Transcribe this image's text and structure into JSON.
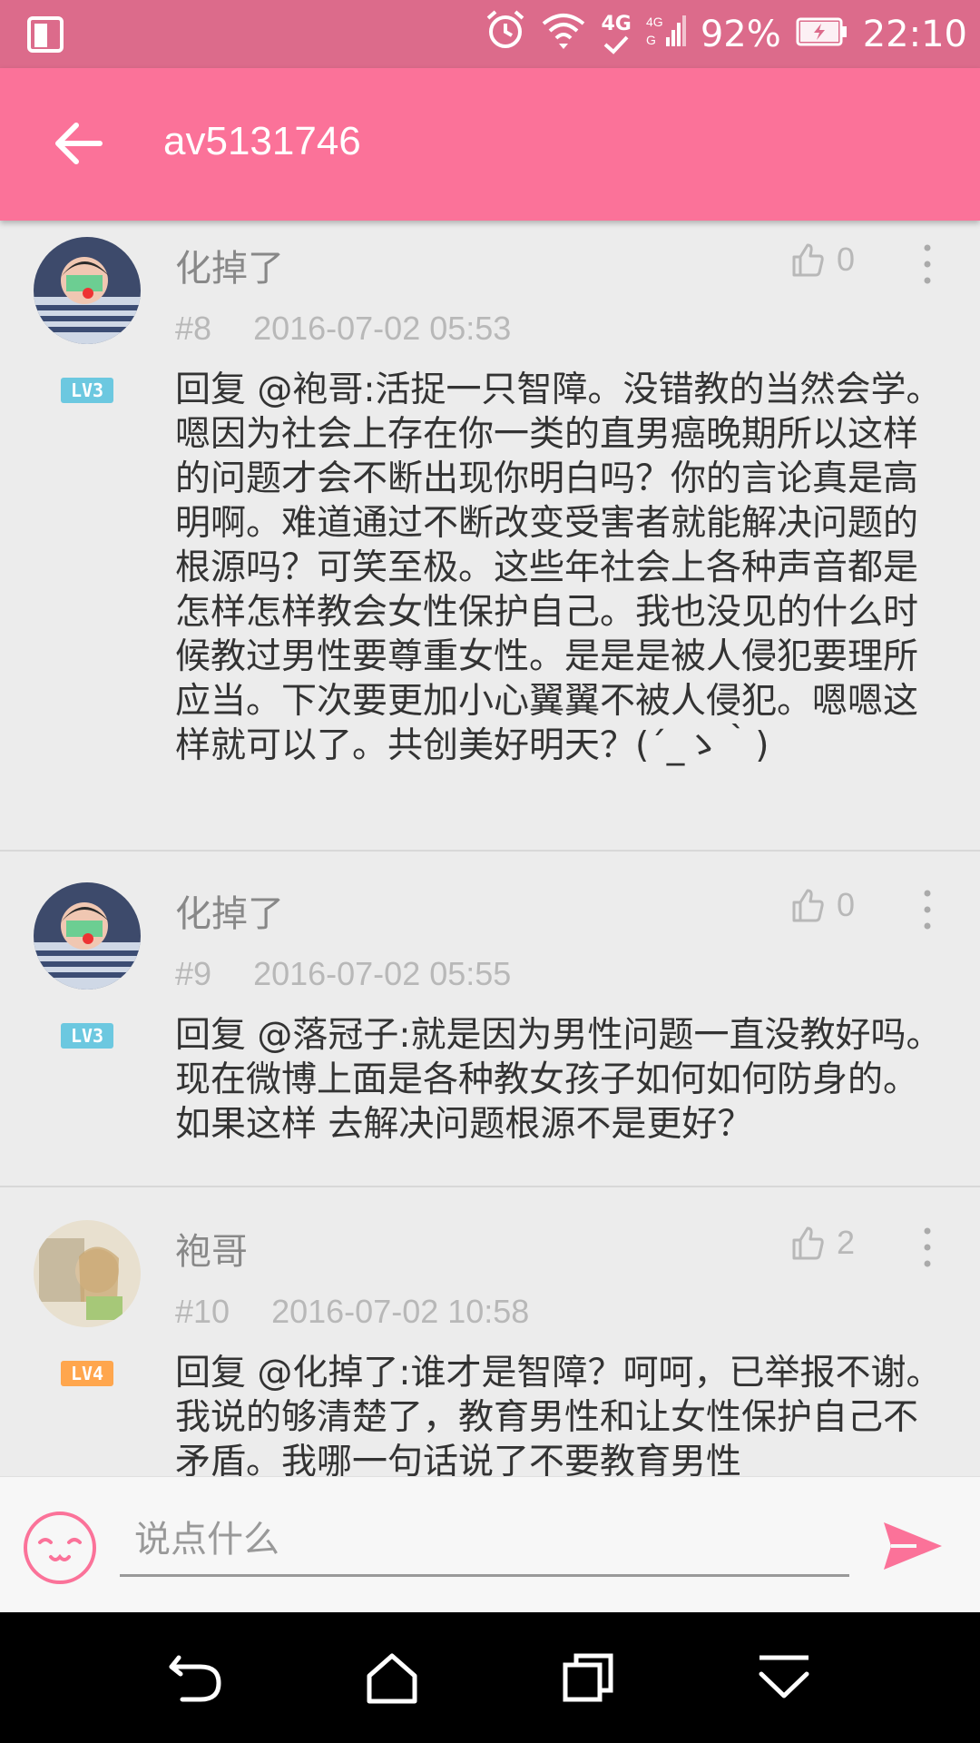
{
  "status_bar": {
    "network": "4G",
    "battery": "92%",
    "time": "22:10"
  },
  "app_bar": {
    "title": "av5131746"
  },
  "comments": [
    {
      "username": "化掉了",
      "floor": "#8",
      "date": "2016-07-02 05:53",
      "likes": "0",
      "level": "LV3",
      "text": "回复 @袍哥:活捉一只智障。没错教的当然会学。嗯因为社会上存在你一类的直男癌晚期所以这样的问题才会不断出现你明白吗？你的言论真是高明啊。难道通过不断改变受害者就能解决问题的根源吗？可笑至极。这些年社会上各种声音都是怎样怎样教会女性保护自己。我也没见的什么时候教过男性要尊重女性。是是是被人侵犯要理所应当。下次要更加小心翼翼不被人侵犯。嗯嗯这样就可以了。共创美好明天？(´_ゝ｀)"
    },
    {
      "username": "化掉了",
      "floor": "#9",
      "date": "2016-07-02 05:55",
      "likes": "0",
      "level": "LV3",
      "text": "回复 @落冠子:就是因为男性问题一直没教好吗。现在微博上面是各种教女孩子如何如何防身的。如果这样 去解决问题根源不是更好？"
    },
    {
      "username": "袍哥",
      "floor": "#10",
      "date": "2016-07-02 10:58",
      "likes": "2",
      "level": "LV4",
      "text": "回复 @化掉了:谁才是智障？呵呵，已举报不谢。我说的够清楚了，教育男性和让女性保护自己不矛盾。我哪一句话说了不要教育男性"
    }
  ],
  "input": {
    "placeholder": "说点什么"
  },
  "colors": {
    "accent": "#fb7299",
    "status_bar": "#dc6b8b",
    "lv3": "#6cc8e0",
    "lv4": "#ffa64d"
  }
}
